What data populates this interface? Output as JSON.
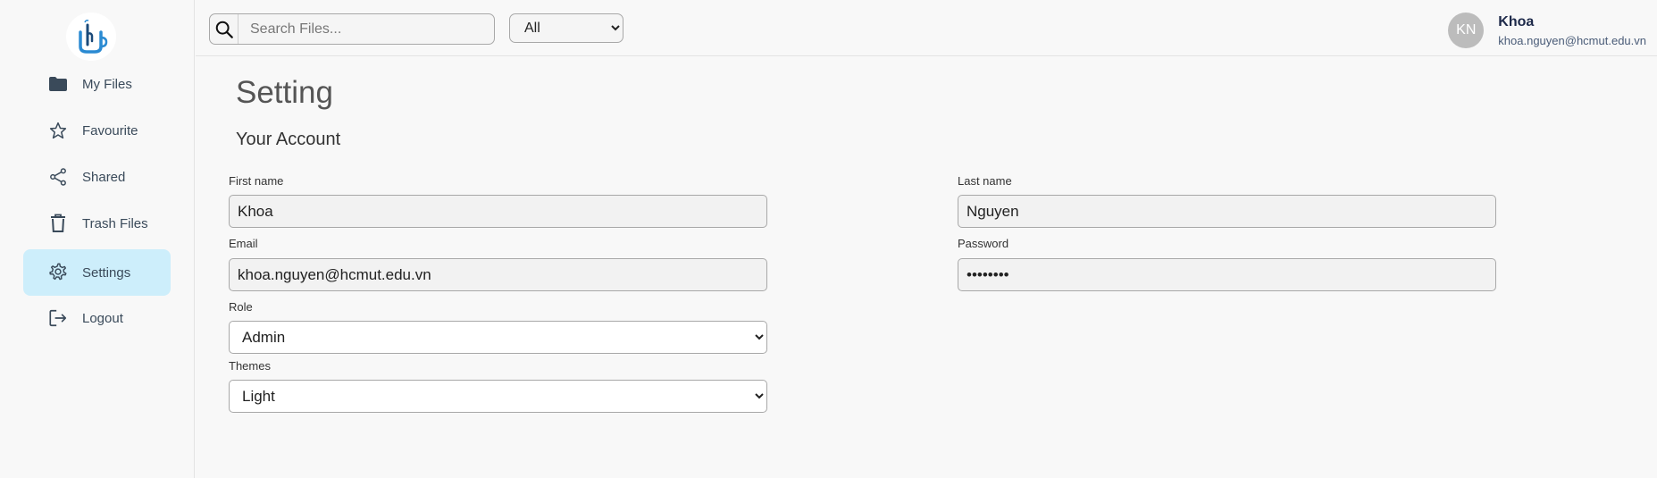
{
  "sidebar": {
    "items": [
      {
        "label": "My Files",
        "icon": "folder-icon"
      },
      {
        "label": "Favourite",
        "icon": "star-icon"
      },
      {
        "label": "Shared",
        "icon": "share-icon"
      },
      {
        "label": "Trash Files",
        "icon": "trash-icon"
      },
      {
        "label": "Settings",
        "icon": "gear-icon",
        "active": true
      },
      {
        "label": "Logout",
        "icon": "logout-icon"
      }
    ]
  },
  "header": {
    "search_placeholder": "Search Files...",
    "search_value": "",
    "filter": {
      "selected": "All"
    },
    "user": {
      "initials": "KN",
      "name": "Khoa",
      "email": "khoa.nguyen@hcmut.edu.vn"
    }
  },
  "main": {
    "title": "Setting",
    "section_title": "Your Account",
    "form": {
      "first_name": {
        "label": "First name",
        "value": "Khoa"
      },
      "last_name": {
        "label": "Last name",
        "value": "Nguyen"
      },
      "email": {
        "label": "Email",
        "value": "khoa.nguyen@hcmut.edu.vn"
      },
      "password": {
        "label": "Password",
        "value": "........"
      },
      "role": {
        "label": "Role",
        "selected": "Admin"
      },
      "themes": {
        "label": "Themes",
        "selected": "Light"
      }
    }
  },
  "colors": {
    "accent": "#cdeefb",
    "background": "#f8f8f8",
    "nav_text": "#3a4a5a",
    "logo_blue": "#2a8ad2"
  }
}
